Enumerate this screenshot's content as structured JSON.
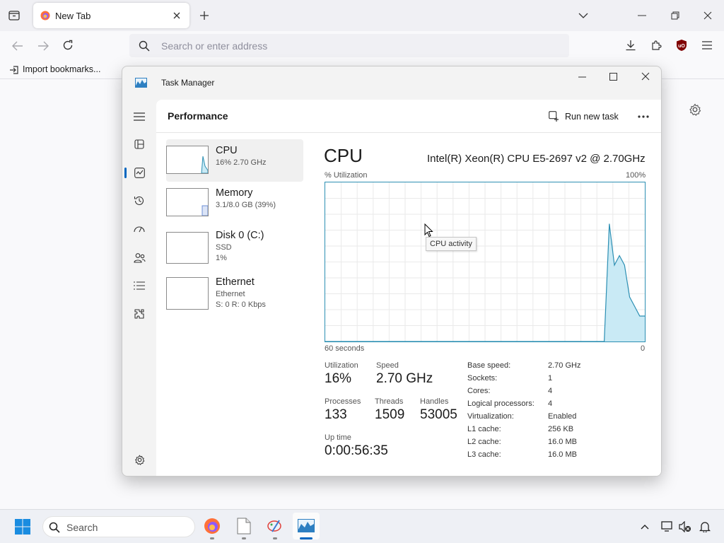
{
  "browser": {
    "tab_title": "New Tab",
    "address_placeholder": "Search or enter address",
    "bookmarks_import_label": "Import bookmarks..."
  },
  "task_manager": {
    "window_title": "Task Manager",
    "header_title": "Performance",
    "run_new_task_label": "Run new task",
    "list": [
      {
        "name": "CPU",
        "sub1": "16% 2.70 GHz"
      },
      {
        "name": "Memory",
        "sub1": "3.1/8.0 GB (39%)"
      },
      {
        "name": "Disk 0 (C:)",
        "sub1": "SSD",
        "sub2": "1%"
      },
      {
        "name": "Ethernet",
        "sub1": "Ethernet",
        "sub2": "S: 0 R: 0 Kbps"
      }
    ],
    "detail": {
      "title": "CPU",
      "processor_name": "Intel(R) Xeon(R) CPU E5-2697 v2 @ 2.70GHz",
      "y_label": "% Utilization",
      "y_max_label": "100%",
      "x_left_label": "60 seconds",
      "x_right_label": "0",
      "tooltip": "CPU activity",
      "stats": {
        "utilization_label": "Utilization",
        "utilization_value": "16%",
        "speed_label": "Speed",
        "speed_value": "2.70 GHz",
        "processes_label": "Processes",
        "processes_value": "133",
        "threads_label": "Threads",
        "threads_value": "1509",
        "handles_label": "Handles",
        "handles_value": "53005",
        "uptime_label": "Up time",
        "uptime_value": "0:00:56:35"
      },
      "specs": [
        {
          "key": "Base speed:",
          "value": "2.70 GHz"
        },
        {
          "key": "Sockets:",
          "value": "1"
        },
        {
          "key": "Cores:",
          "value": "4"
        },
        {
          "key": "Logical processors:",
          "value": "4"
        },
        {
          "key": "Virtualization:",
          "value": "Enabled"
        },
        {
          "key": "L1 cache:",
          "value": "256 KB"
        },
        {
          "key": "L2 cache:",
          "value": "16.0 MB"
        },
        {
          "key": "L3 cache:",
          "value": "16.0 MB"
        }
      ],
      "chart_data": {
        "type": "area",
        "xlabel": "60 seconds",
        "ylabel": "% Utilization",
        "x": [
          60,
          59,
          58,
          57,
          56,
          55,
          54,
          53,
          52,
          51,
          50,
          49,
          48,
          47,
          46,
          45,
          44,
          43,
          42,
          41,
          40,
          39,
          38,
          37,
          36,
          35,
          34,
          33,
          32,
          31,
          30,
          29,
          28,
          27,
          26,
          25,
          24,
          23,
          22,
          21,
          20,
          19,
          18,
          17,
          16,
          15,
          14,
          13,
          12,
          11,
          10,
          9,
          8,
          7,
          6,
          5,
          4,
          3,
          2,
          1,
          0
        ],
        "values": [
          0,
          0,
          0,
          0,
          0,
          0,
          0,
          0,
          0,
          0,
          0,
          0,
          0,
          0,
          0,
          0,
          0,
          0,
          0,
          0,
          0,
          0,
          0,
          0,
          0,
          0,
          0,
          0,
          0,
          0,
          0,
          0,
          0,
          0,
          0,
          0,
          0,
          0,
          0,
          0,
          0,
          0,
          0,
          0,
          0,
          0,
          0,
          0,
          0,
          0,
          0,
          0,
          0,
          0,
          0,
          0,
          74,
          48,
          54,
          48,
          28,
          22,
          16,
          16
        ],
        "ylim": [
          0,
          100
        ],
        "xlim": [
          60,
          0
        ],
        "color": "#2c8fb3",
        "fill": "#c9eaf5"
      }
    }
  },
  "taskbar": {
    "search_label": "Search"
  },
  "colors": {
    "accent": "#0067c0",
    "chart_line": "#2c8fb3",
    "chart_fill": "#c9eaf5"
  }
}
